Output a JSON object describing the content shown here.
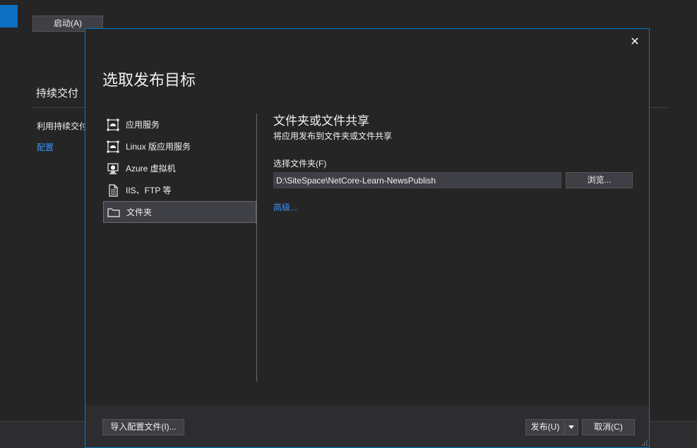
{
  "background": {
    "start_button": "启动(A)",
    "section_title": "持续交付",
    "description": "利用持续交付",
    "config_link": "配置"
  },
  "dialog": {
    "title": "选取发布目标",
    "close_glyph": "✕",
    "targets": [
      {
        "label": "应用服务",
        "icon": "app-service-icon"
      },
      {
        "label": "Linux 版应用服务",
        "icon": "linux-app-service-icon"
      },
      {
        "label": "Azure 虚拟机",
        "icon": "azure-vm-icon"
      },
      {
        "label": "IIS、FTP 等",
        "icon": "document-icon"
      },
      {
        "label": "文件夹",
        "icon": "folder-icon",
        "selected": true
      }
    ],
    "pane": {
      "title": "文件夹或文件共享",
      "subtitle": "将应用发布到文件夹或文件共享",
      "field_label": "选择文件夹(F)",
      "path_value": "D:\\SiteSpace\\NetCore-Learn-NewsPublish",
      "browse_label": "浏览...",
      "advanced_link": "高级..."
    },
    "footer": {
      "import_label": "导入配置文件(I)...",
      "publish_label": "发布(U)",
      "cancel_label": "取消(C)"
    }
  },
  "colors": {
    "accent": "#007acc",
    "link": "#3794ff",
    "background": "#252526",
    "selection": "#3f3f46"
  }
}
